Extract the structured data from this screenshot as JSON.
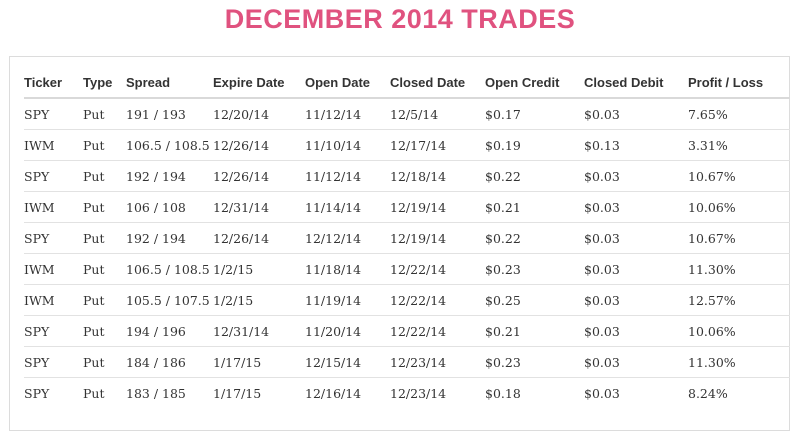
{
  "page": {
    "title": "DECEMBER 2014 TRADES"
  },
  "table": {
    "headers": {
      "ticker": "Ticker",
      "type": "Type",
      "spread": "Spread",
      "expire_date": "Expire Date",
      "open_date": "Open Date",
      "closed_date": "Closed Date",
      "open_credit": "Open Credit",
      "closed_debit": "Closed Debit",
      "profit_loss": "Profit / Loss"
    },
    "rows": [
      {
        "ticker": "SPY",
        "type": "Put",
        "spread": "191 / 193",
        "expire_date": "12/20/14",
        "open_date": "11/12/14",
        "closed_date": "12/5/14",
        "open_credit": "$0.17",
        "closed_debit": "$0.03",
        "profit_loss": "7.65%"
      },
      {
        "ticker": "IWM",
        "type": "Put",
        "spread": "106.5 / 108.5",
        "expire_date": "12/26/14",
        "open_date": "11/10/14",
        "closed_date": "12/17/14",
        "open_credit": "$0.19",
        "closed_debit": "$0.13",
        "profit_loss": "3.31%"
      },
      {
        "ticker": "SPY",
        "type": "Put",
        "spread": "192 / 194",
        "expire_date": "12/26/14",
        "open_date": "11/12/14",
        "closed_date": "12/18/14",
        "open_credit": "$0.22",
        "closed_debit": "$0.03",
        "profit_loss": "10.67%"
      },
      {
        "ticker": "IWM",
        "type": "Put",
        "spread": "106 / 108",
        "expire_date": "12/31/14",
        "open_date": "11/14/14",
        "closed_date": "12/19/14",
        "open_credit": "$0.21",
        "closed_debit": "$0.03",
        "profit_loss": "10.06%"
      },
      {
        "ticker": "SPY",
        "type": "Put",
        "spread": "192 / 194",
        "expire_date": "12/26/14",
        "open_date": "12/12/14",
        "closed_date": "12/19/14",
        "open_credit": "$0.22",
        "closed_debit": "$0.03",
        "profit_loss": "10.67%"
      },
      {
        "ticker": "IWM",
        "type": "Put",
        "spread": "106.5 / 108.5",
        "expire_date": "1/2/15",
        "open_date": "11/18/14",
        "closed_date": "12/22/14",
        "open_credit": "$0.23",
        "closed_debit": "$0.03",
        "profit_loss": "11.30%"
      },
      {
        "ticker": "IWM",
        "type": "Put",
        "spread": "105.5 / 107.5",
        "expire_date": "1/2/15",
        "open_date": "11/19/14",
        "closed_date": "12/22/14",
        "open_credit": "$0.25",
        "closed_debit": "$0.03",
        "profit_loss": "12.57%"
      },
      {
        "ticker": "SPY",
        "type": "Put",
        "spread": "194 / 196",
        "expire_date": "12/31/14",
        "open_date": "11/20/14",
        "closed_date": "12/22/14",
        "open_credit": "$0.21",
        "closed_debit": "$0.03",
        "profit_loss": "10.06%"
      },
      {
        "ticker": "SPY",
        "type": "Put",
        "spread": "184 / 186",
        "expire_date": "1/17/15",
        "open_date": "12/15/14",
        "closed_date": "12/23/14",
        "open_credit": "$0.23",
        "closed_debit": "$0.03",
        "profit_loss": "11.30%"
      },
      {
        "ticker": "SPY",
        "type": "Put",
        "spread": "183 / 185",
        "expire_date": "1/17/15",
        "open_date": "12/16/14",
        "closed_date": "12/23/14",
        "open_credit": "$0.18",
        "closed_debit": "$0.03",
        "profit_loss": "8.24%"
      }
    ]
  },
  "colors": {
    "title": "#e0527f",
    "text": "#333333",
    "panel_border": "#dcdcdc",
    "row_divider": "#e2e2e2"
  }
}
